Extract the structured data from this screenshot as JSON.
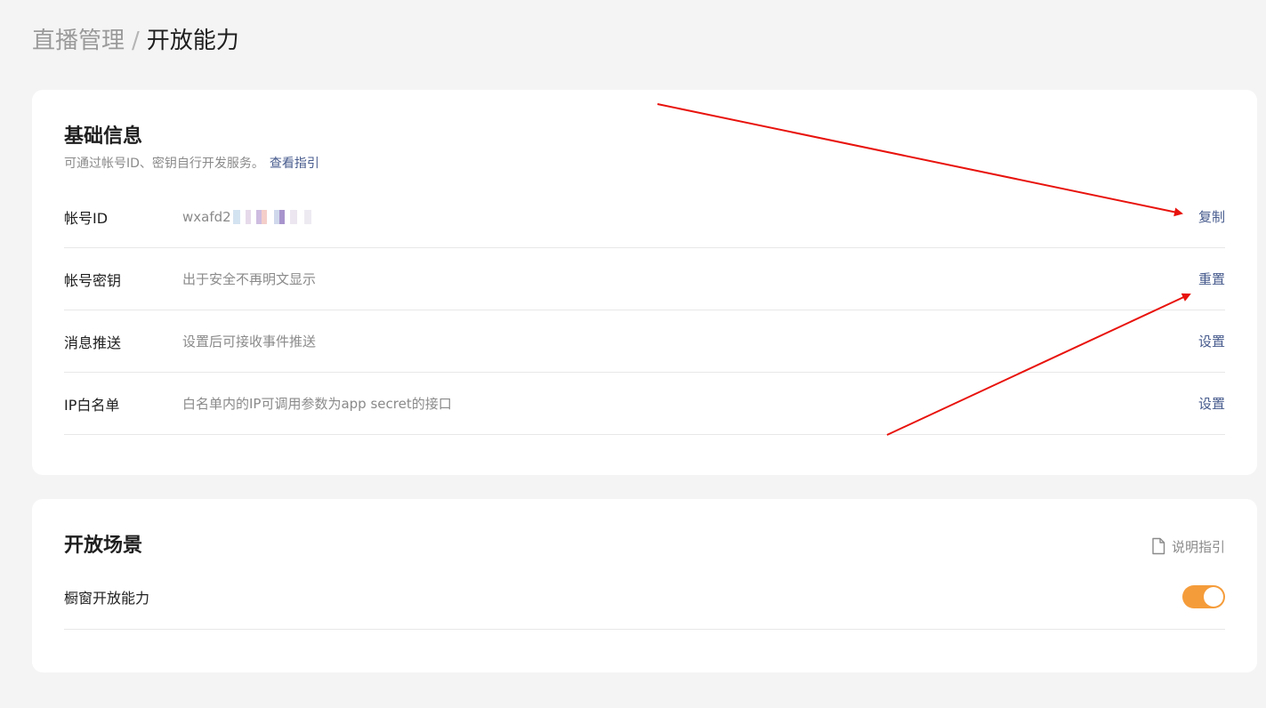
{
  "breadcrumb": {
    "parent": "直播管理",
    "separator": "/",
    "current": "开放能力"
  },
  "basic_info": {
    "title": "基础信息",
    "subtitle": "可通过帐号ID、密钥自行开发服务。",
    "guide_link": "查看指引",
    "rows": [
      {
        "label": "帐号ID",
        "value": "wxafd2",
        "action": "复制"
      },
      {
        "label": "帐号密钥",
        "value": "出于安全不再明文显示",
        "action": "重置"
      },
      {
        "label": "消息推送",
        "value": "设置后可接收事件推送",
        "action": "设置"
      },
      {
        "label": "IP白名单",
        "value": "白名单内的IP可调用参数为app secret的接口",
        "action": "设置"
      }
    ]
  },
  "open_scene": {
    "title": "开放场景",
    "guide_link": "说明指引",
    "guide_icon": "document-icon",
    "items": [
      {
        "label": "橱窗开放能力",
        "enabled": true
      }
    ]
  },
  "colors": {
    "accent_link": "#465a8c",
    "toggle_on": "#f59c3a",
    "annotation_arrow": "#e8120c"
  }
}
